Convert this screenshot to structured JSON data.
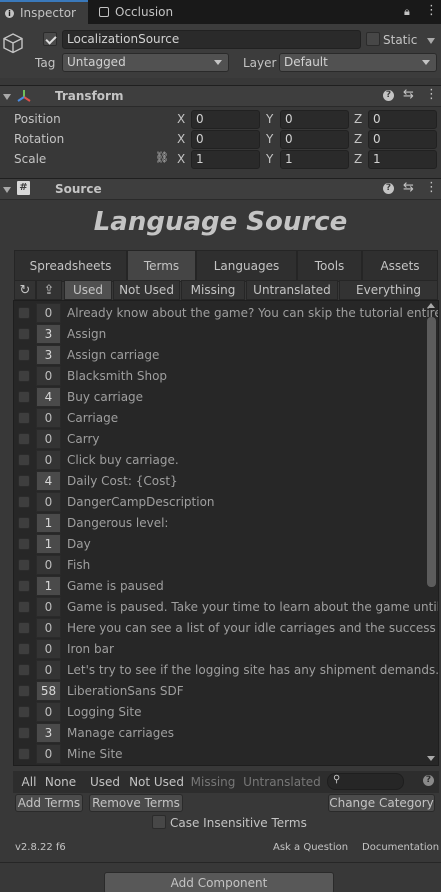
{
  "tabs": {
    "inspector": "Inspector",
    "occlusion": "Occlusion"
  },
  "object": {
    "name": "LocalizationSource",
    "static_label": "Static",
    "tag_label": "Tag",
    "tag_value": "Untagged",
    "layer_label": "Layer",
    "layer_value": "Default"
  },
  "transform": {
    "title": "Transform",
    "position": "Position",
    "rotation": "Rotation",
    "scale": "Scale",
    "pos": {
      "x": "0",
      "y": "0",
      "z": "0"
    },
    "rot": {
      "x": "0",
      "y": "0",
      "z": "0"
    },
    "scl": {
      "x": "1",
      "y": "1",
      "z": "1"
    },
    "axes": {
      "x": "X",
      "y": "Y",
      "z": "Z"
    }
  },
  "source": {
    "title": "Source",
    "heading": "Language Source"
  },
  "main_tabs": [
    "Spreadsheets",
    "Terms",
    "Languages",
    "Tools",
    "Assets"
  ],
  "filter_tabs": [
    "Used",
    "Not Used",
    "Missing",
    "Untranslated",
    "Everything"
  ],
  "terms": [
    {
      "count": "0",
      "term": "Already know about the game? You can skip the tutorial entirely."
    },
    {
      "count": "3",
      "term": "Assign"
    },
    {
      "count": "3",
      "term": "Assign carriage"
    },
    {
      "count": "0",
      "term": "Blacksmith Shop"
    },
    {
      "count": "4",
      "term": "Buy carriage"
    },
    {
      "count": "0",
      "term": "Carriage"
    },
    {
      "count": "0",
      "term": "Carry"
    },
    {
      "count": "0",
      "term": "Click buy carriage."
    },
    {
      "count": "4",
      "term": "Daily Cost: {Cost}"
    },
    {
      "count": "0",
      "term": "DangerCampDescription"
    },
    {
      "count": "1",
      "term": "Dangerous level:"
    },
    {
      "count": "1",
      "term": "Day"
    },
    {
      "count": "0",
      "term": "Fish"
    },
    {
      "count": "1",
      "term": "Game is paused"
    },
    {
      "count": "0",
      "term": "Game is paused. Take your time to learn about the game until you"
    },
    {
      "count": "0",
      "term": "Here you can see a list of your idle carriages and the success rate"
    },
    {
      "count": "0",
      "term": "Iron bar"
    },
    {
      "count": "0",
      "term": "Let's try to see if the logging site has any shipment demands. Click"
    },
    {
      "count": "58",
      "term": "LiberationSans SDF"
    },
    {
      "count": "0",
      "term": "Logging Site"
    },
    {
      "count": "3",
      "term": "Manage carriages"
    },
    {
      "count": "0",
      "term": "Mine Site"
    }
  ],
  "bottom": {
    "all": "All",
    "none": "None",
    "used": "Used",
    "not_used": "Not Used",
    "missing": "Missing",
    "untranslated": "Untranslated",
    "add_terms": "Add Terms",
    "remove_terms": "Remove Terms",
    "change_category": "Change Category",
    "case_insensitive": "Case Insensitive Terms",
    "version": "v2.8.22 f6",
    "ask": "Ask a Question",
    "docs": "Documentation",
    "add_component": "Add Component"
  }
}
